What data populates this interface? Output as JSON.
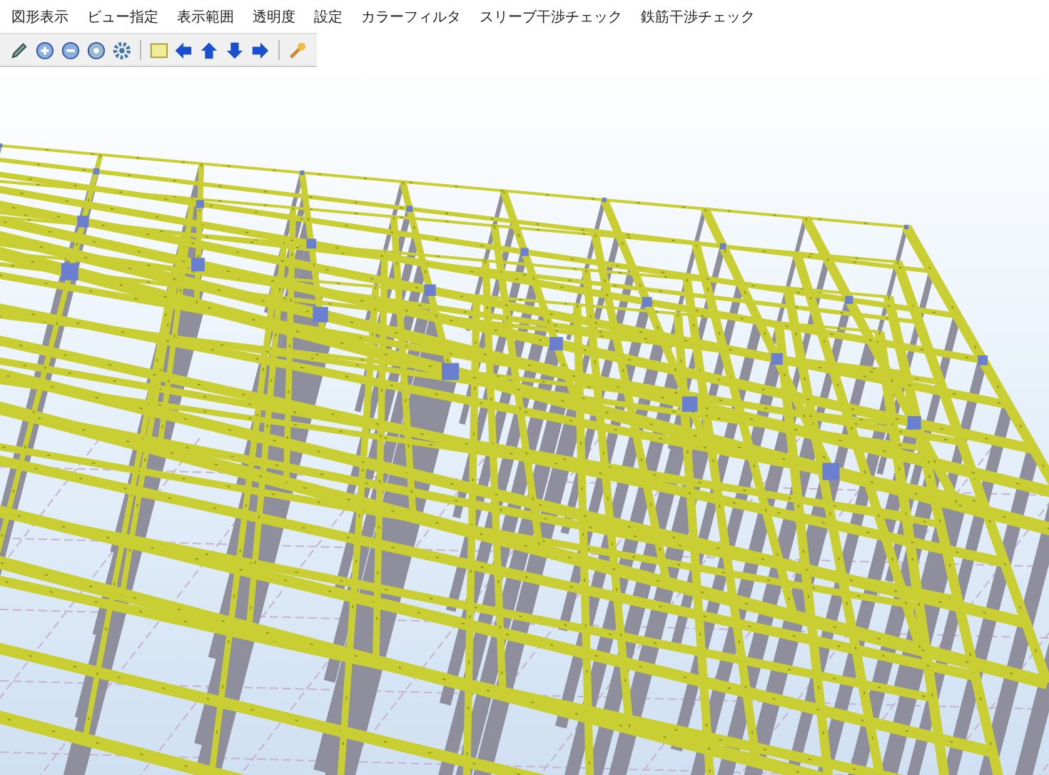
{
  "menu_bar": {
    "items": [
      {
        "label": "図形表示"
      },
      {
        "label": "ビュー指定"
      },
      {
        "label": "表示範囲"
      },
      {
        "label": "透明度"
      },
      {
        "label": "設定"
      },
      {
        "label": "カラーフィルタ"
      },
      {
        "label": "スリーブ干渉チェック"
      },
      {
        "label": "鉄筋干渉チェック"
      }
    ]
  }
}
